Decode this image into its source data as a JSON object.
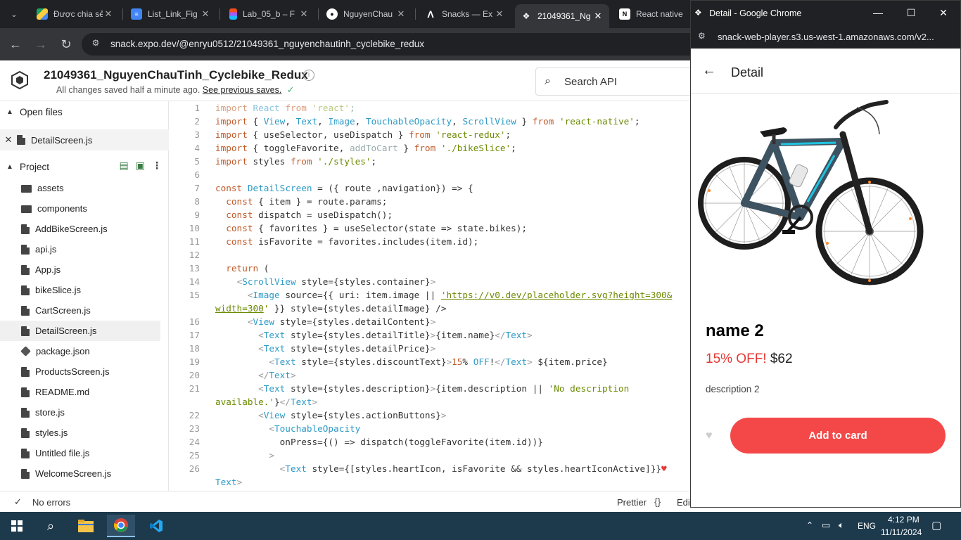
{
  "browser": {
    "tabs": [
      {
        "title": "Được chia sẻ",
        "icon": "google-drive-icon"
      },
      {
        "title": "List_Link_Fig",
        "icon": "google-docs-icon"
      },
      {
        "title": "Lab_05_b – F",
        "icon": "figma-icon"
      },
      {
        "title": "NguyenChau",
        "icon": "github-icon"
      },
      {
        "title": "Snacks — Ex",
        "icon": "expo-icon"
      },
      {
        "title": "21049361_Ng",
        "icon": "snack-icon",
        "active": true
      },
      {
        "title": "React native",
        "icon": "notion-icon"
      }
    ],
    "url": "snack.expo.dev/@enryu0512/21049361_nguyenchautinh_cyclebike_redux"
  },
  "snack": {
    "project_title": "21049361_NguyenChauTinh_Cyclebike_Redux",
    "save_status": "All changes saved half a minute ago.",
    "previous_saves": "See previous saves.",
    "search_placeholder": "Search API"
  },
  "sidebar": {
    "open_files_label": "Open files",
    "open_file": "DetailScreen.js",
    "project_label": "Project",
    "files": [
      {
        "name": "assets",
        "type": "folder"
      },
      {
        "name": "components",
        "type": "folder"
      },
      {
        "name": "AddBikeScreen.js",
        "type": "doc"
      },
      {
        "name": "api.js",
        "type": "doc"
      },
      {
        "name": "App.js",
        "type": "doc"
      },
      {
        "name": "bikeSlice.js",
        "type": "doc"
      },
      {
        "name": "CartScreen.js",
        "type": "doc"
      },
      {
        "name": "DetailScreen.js",
        "type": "doc",
        "selected": true
      },
      {
        "name": "package.json",
        "type": "pkg"
      },
      {
        "name": "ProductsScreen.js",
        "type": "doc"
      },
      {
        "name": "README.md",
        "type": "doc"
      },
      {
        "name": "store.js",
        "type": "doc"
      },
      {
        "name": "styles.js",
        "type": "doc"
      },
      {
        "name": "Untitled file.js",
        "type": "doc"
      },
      {
        "name": "WelcomeScreen.js",
        "type": "doc"
      }
    ]
  },
  "statusbar": {
    "errors": "No errors",
    "prettier": "Prettier",
    "braces": "{}",
    "edit": "Edit"
  },
  "popup": {
    "window_title": "Detail - Google Chrome",
    "url": "snack-web-player.s3.us-west-1.amazonaws.com/v2...",
    "header_title": "Detail",
    "item_name": "name 2",
    "discount": "15% OFF!",
    "price": "$62",
    "description": "description 2",
    "button": "Add to card"
  },
  "taskbar": {
    "lang": "ENG",
    "time": "4:12 PM",
    "date": "11/11/2024"
  },
  "colors": {
    "accent_red": "#f44848",
    "discount_red": "#e53935"
  }
}
